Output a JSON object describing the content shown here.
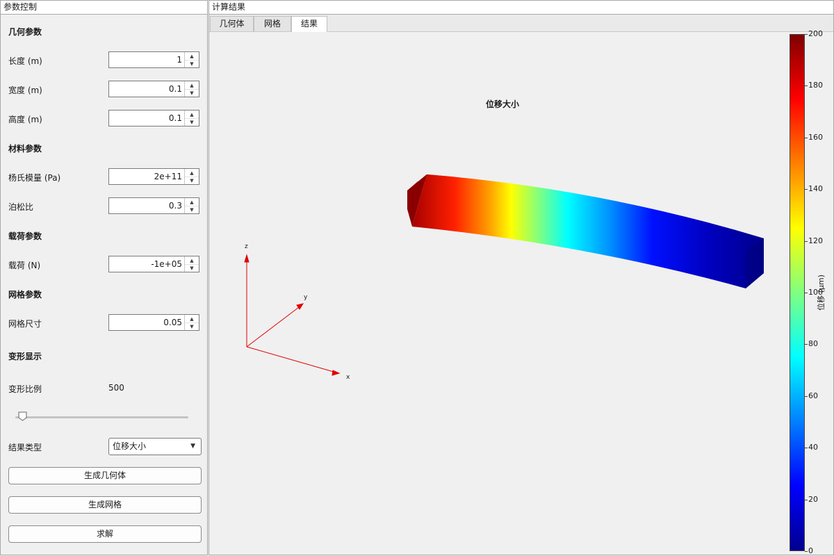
{
  "left_panel": {
    "title": "参数控制",
    "sections": {
      "geometry": "几何参数",
      "material": "材料参数",
      "load": "载荷参数",
      "mesh": "网格参数",
      "deform": "变形显示"
    },
    "fields": {
      "length": {
        "label": "长度 (m)",
        "value": "1"
      },
      "width": {
        "label": "宽度 (m)",
        "value": "0.1"
      },
      "height": {
        "label": "高度 (m)",
        "value": "0.1"
      },
      "youngs": {
        "label": "杨氏模量 (Pa)",
        "value": "2e+11"
      },
      "poisson": {
        "label": "泊松比",
        "value": "0.3"
      },
      "load": {
        "label": "载荷 (N)",
        "value": "-1e+05"
      },
      "mesh_size": {
        "label": "网格尺寸",
        "value": "0.05"
      }
    },
    "deform_scale": {
      "label": "变形比例",
      "value": "500",
      "slider_fraction": 0.04
    },
    "result_type": {
      "label": "结果类型",
      "selected": "位移大小"
    },
    "buttons": {
      "gen_geometry": "生成几何体",
      "gen_mesh": "生成网格",
      "solve": "求解"
    }
  },
  "right_panel": {
    "title": "计算结果",
    "tabs": [
      {
        "label": "几何体",
        "active": false
      },
      {
        "label": "网格",
        "active": false
      },
      {
        "label": "结果",
        "active": true
      }
    ],
    "plot": {
      "title": "位移大小",
      "axes": {
        "x": "x",
        "y": "y",
        "z": "z"
      },
      "colorbar": {
        "label": "位移 (μm)",
        "ticks": [
          "200",
          "180",
          "160",
          "140",
          "120",
          "100",
          "80",
          "60",
          "40",
          "20",
          "0"
        ],
        "min": 0,
        "max": 200,
        "colormap": "jet"
      }
    }
  },
  "colors": {
    "axis_red": "#e00000",
    "panel_bg": "#f0f0f0",
    "border": "#a8a8a8"
  }
}
